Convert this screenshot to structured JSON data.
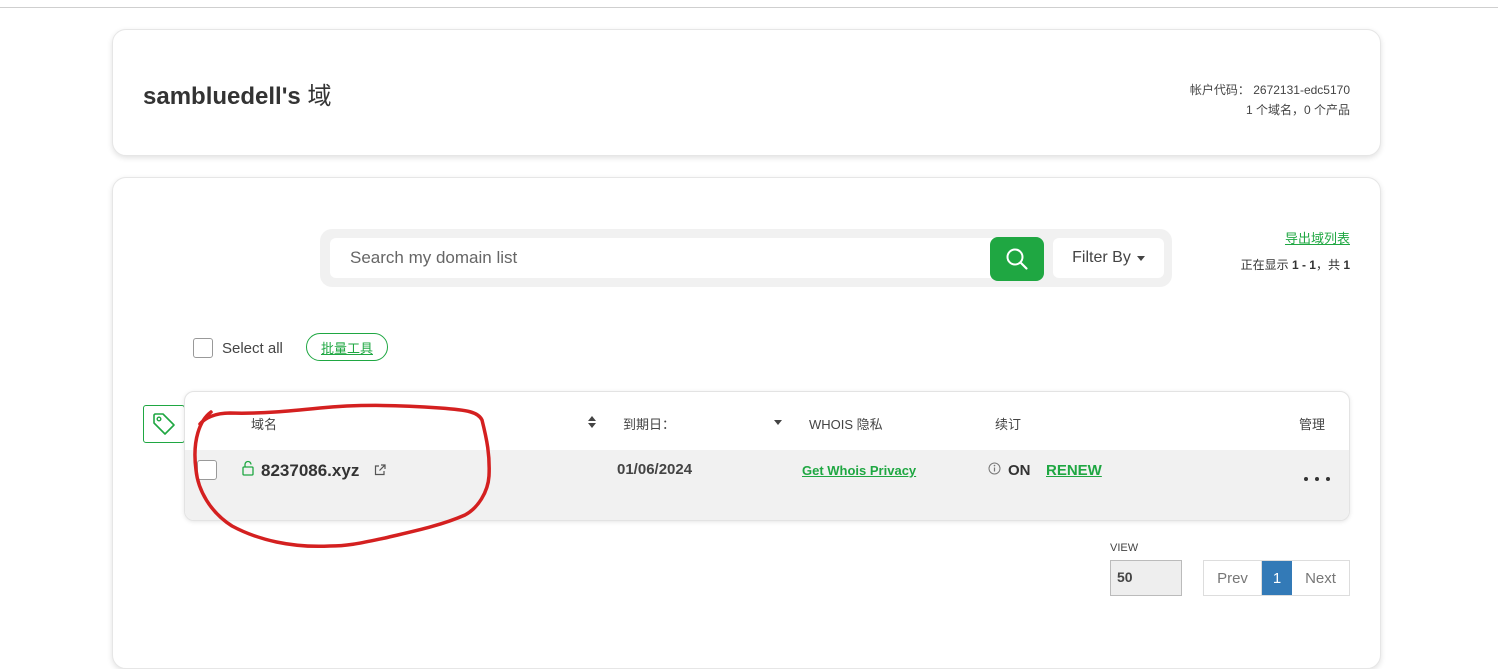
{
  "account": {
    "title_name": "sambluedell's",
    "title_suffix": "域",
    "code_line": "帐户代码： 2672131-edc5170",
    "summary_line": "1 个域名，0 个产品"
  },
  "search": {
    "placeholder": "Search my domain list",
    "filter_label": "Filter By"
  },
  "export": {
    "link_label": "导出域列表",
    "showing_prefix": "正在显示 ",
    "showing_range": "1 - 1",
    "showing_mid": "，共 ",
    "showing_total": "1"
  },
  "bulk": {
    "select_all_label": "Select all",
    "bulk_tools_label": "批量工具"
  },
  "table": {
    "headers": {
      "domain": "域名",
      "expires": "到期日：",
      "whois": "WHOIS 隐私",
      "renewal": "续订",
      "manage": "管理"
    },
    "rows": [
      {
        "domain": "8237086.xyz",
        "expires": "01/06/2024",
        "whois_action": "Get Whois Privacy",
        "renew_status": "ON",
        "renew_action": "RENEW"
      }
    ]
  },
  "pagination": {
    "view_label": "VIEW",
    "per_page": "50",
    "prev_label": "Prev",
    "current_page": "1",
    "next_label": "Next"
  },
  "colors": {
    "accent_green": "#1fa742",
    "pager_active": "#337ab7",
    "annotation_red": "#d42020"
  },
  "icons": [
    "search-icon",
    "caret-down-icon",
    "tag-icon",
    "sort-icon",
    "lock-icon",
    "external-link-icon",
    "info-icon",
    "more-icon"
  ]
}
